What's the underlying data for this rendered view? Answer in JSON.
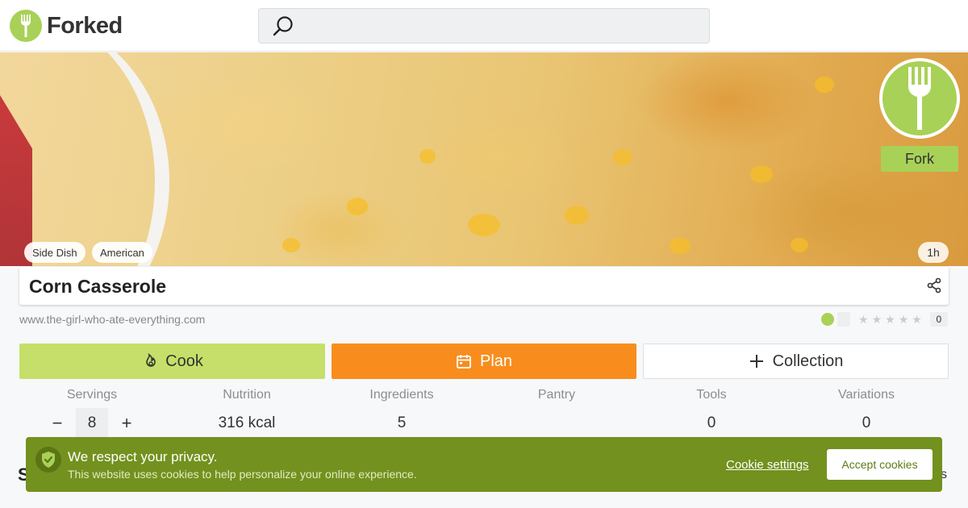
{
  "brand": {
    "name": "Forked",
    "color": "#a8d157"
  },
  "search": {
    "placeholder": ""
  },
  "hero": {
    "tags": [
      "Side Dish",
      "American"
    ],
    "time": "1h",
    "fork_label": "Fork"
  },
  "recipe": {
    "title": "Corn Casserole",
    "source": "www.the-girl-who-ate-everything.com",
    "rating_count": "0",
    "stars": 0
  },
  "actions": {
    "cook": "Cook",
    "plan": "Plan",
    "collection": "Collection"
  },
  "stats": {
    "labels": [
      "Servings",
      "Nutrition",
      "Ingredients",
      "Pantry",
      "Tools",
      "Variations"
    ],
    "servings": "8",
    "nutrition": "316 kcal",
    "ingredients": "5",
    "pantry": "",
    "tools": "0",
    "variations": "0"
  },
  "cookie": {
    "title": "We respect your privacy.",
    "subtitle": "This website uses cookies to help personalize your online experience.",
    "settings": "Cookie settings",
    "accept": "Accept cookies"
  },
  "below": {
    "left": "S",
    "right": "s"
  },
  "colors": {
    "cook": "#c5df6a",
    "plan": "#f88d1e",
    "cookie_bar": "#73911e"
  }
}
